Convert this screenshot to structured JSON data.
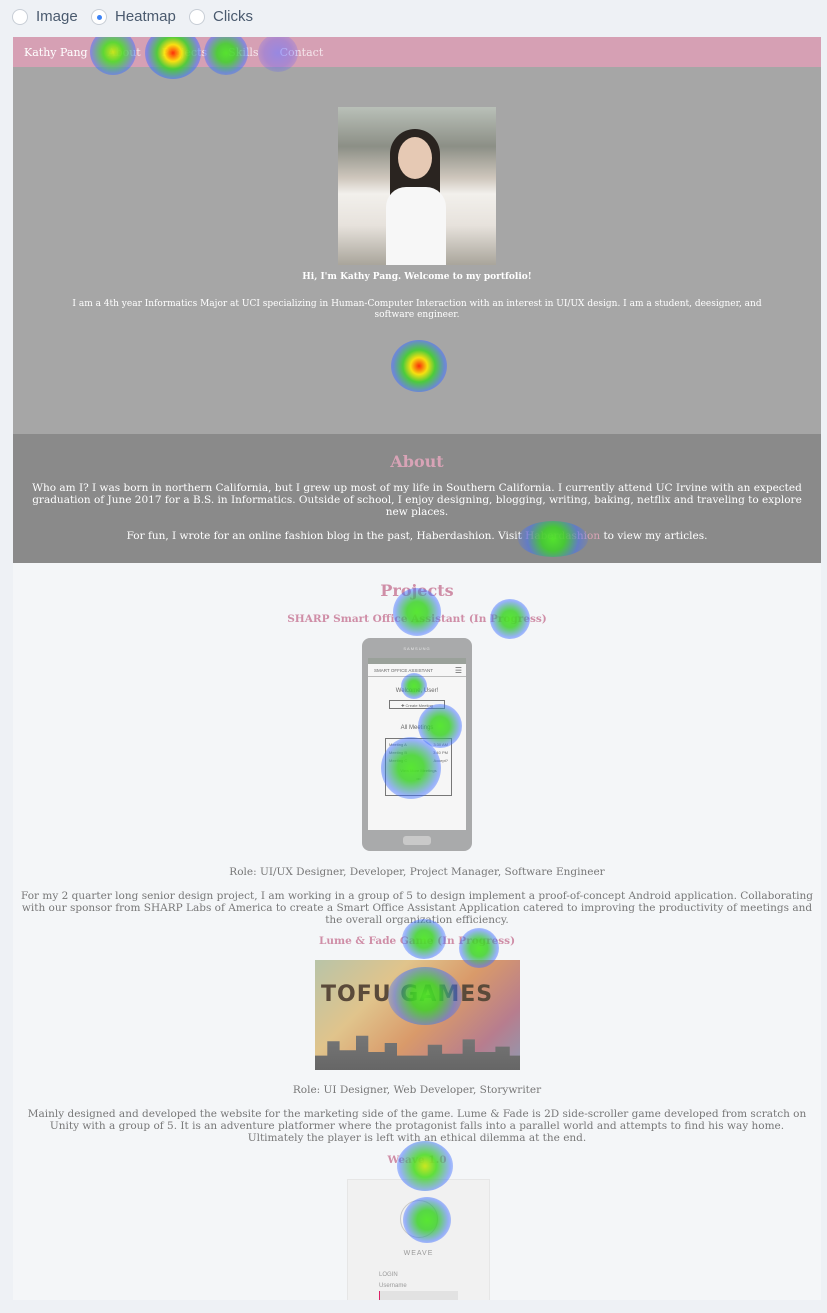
{
  "view_modes": [
    {
      "label": "Image",
      "selected": false
    },
    {
      "label": "Heatmap",
      "selected": true
    },
    {
      "label": "Clicks",
      "selected": false
    }
  ],
  "navbar": {
    "brand": "Kathy Pang",
    "items": [
      "About",
      "Projects",
      "Skills",
      "Contact"
    ]
  },
  "hero": {
    "title": "Hi, I'm Kathy Pang. Welcome to my portfolio!",
    "text": "I am a 4th year Informatics Major at UCI specializing in Human-Computer Interaction with an interest in UI/UX design. I am a student, deesigner, and software engineer."
  },
  "about": {
    "heading": "About",
    "paragraph1": "Who am I? I was born in northern California, but I grew up most of my life in Southern California. I currently attend UC Irvine with an expected graduation of June 2017 for a B.S. in Informatics. Outside of school, I enjoy designing, blogging, writing, baking, netflix and traveling to explore new places.",
    "paragraph2_before": "For fun, I wrote for an online fashion blog in the past, Haberdashion. Visit ",
    "link": "Haberdashion",
    "paragraph2_after": " to view my articles."
  },
  "projects": {
    "heading": "Projects",
    "items": [
      {
        "title": "SHARP Smart Office Assistant (In Progress)",
        "role": "Role: UI/UX Designer, Developer, Project Manager, Software Engineer",
        "description": "For my 2 quarter long senior design project, I am working in a group of 5 to design implement a proof-of-concept Android application. Collaborating with our sponsor from SHARP Labs of America to create a Smart Office Assistant Application catered to improving the productivity of meetings and the overall organization efficiency."
      },
      {
        "title": "Lume & Fade Game (In Progress)",
        "role": "Role: UI Designer, Web Developer, Storywriter",
        "description": "Mainly designed and developed the website for the marketing side of the game. Lume & Fade is 2D side-scroller game developed from scratch on Unity with a group of 5. It is an adventure platformer where the protagonist falls into a parallel world and attempts to find his way home. Ultimately the player is left with an ethical dilemma at the end."
      },
      {
        "title": "Weave 1.0"
      }
    ]
  },
  "phone_screen": {
    "brand": "SAMSUNG",
    "app_title": "SMART OFFICE ASSISTANT",
    "welcome": "Welcome, User!",
    "create_button": "Create Meeting",
    "all_meetings": "All Meetings",
    "meetings": [
      {
        "name": "Meeting A",
        "time": "3:30 AM"
      },
      {
        "name": "Meeting B",
        "time": "3:40 PM"
      },
      {
        "name": "Meeting C",
        "time": "Accept?"
      }
    ],
    "view_more": "View More Meetings",
    "ellipsis": "•••"
  },
  "banner": {
    "logo_text": "TOFU GAMES"
  },
  "weave_screen": {
    "logo": "WEAVE",
    "login": "LOGIN",
    "username": "Username"
  }
}
